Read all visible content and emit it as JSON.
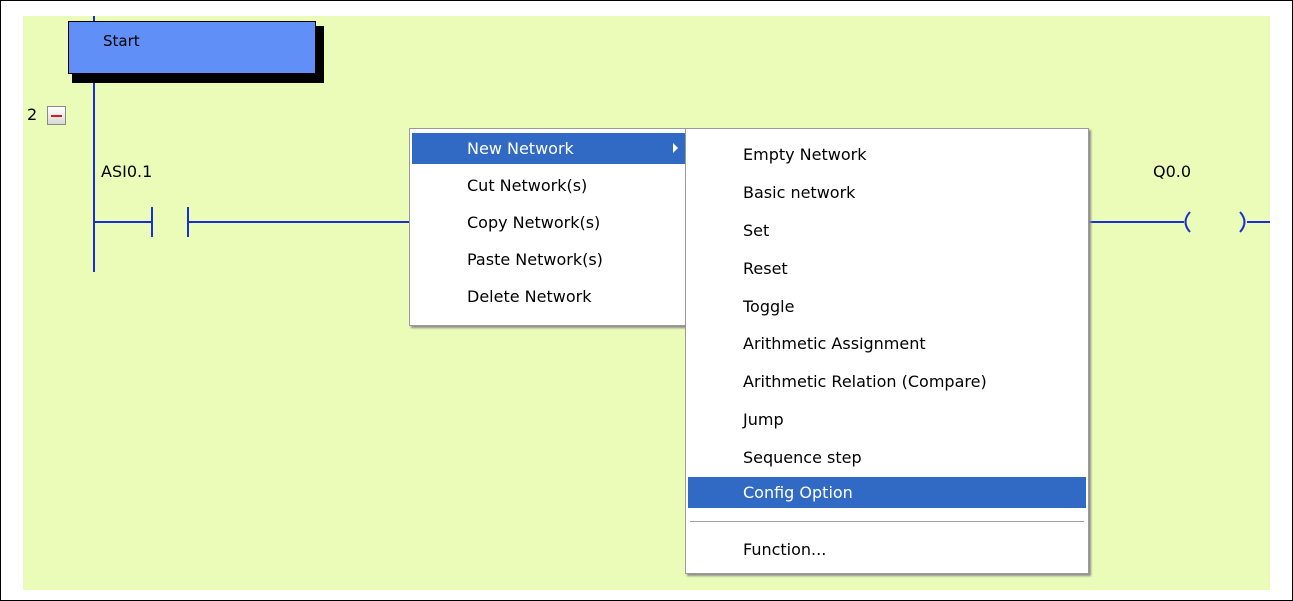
{
  "editor": {
    "network_number": "2",
    "step_label": "Start",
    "contact_label": "ASI0.1",
    "coil_label": "Q0.0"
  },
  "context_menu": {
    "items": [
      {
        "label": "New Network",
        "has_submenu": true,
        "highlighted": true
      },
      {
        "label": "Cut Network(s)"
      },
      {
        "label": "Copy Network(s)"
      },
      {
        "label": "Paste Network(s)"
      },
      {
        "label": "Delete Network"
      }
    ]
  },
  "submenu": {
    "items": [
      {
        "label": "Empty Network"
      },
      {
        "label": "Basic network"
      },
      {
        "label": "Set"
      },
      {
        "label": "Reset"
      },
      {
        "label": "Toggle"
      },
      {
        "label": "Arithmetic Assignment"
      },
      {
        "label": "Arithmetic Relation (Compare)"
      },
      {
        "label": "Jump"
      },
      {
        "label": "Sequence step"
      },
      {
        "label": "Config Option",
        "highlighted": true
      },
      {
        "label": "Function..."
      }
    ]
  },
  "colors": {
    "canvas_background": "#eafcb8",
    "step_fill": "#5f8ff7",
    "ladder_wire": "#1a2fd0",
    "menu_highlight": "#316ac5"
  },
  "icons": {
    "collapse": "minus-icon",
    "submenu_arrow": "triangle-right-icon"
  }
}
